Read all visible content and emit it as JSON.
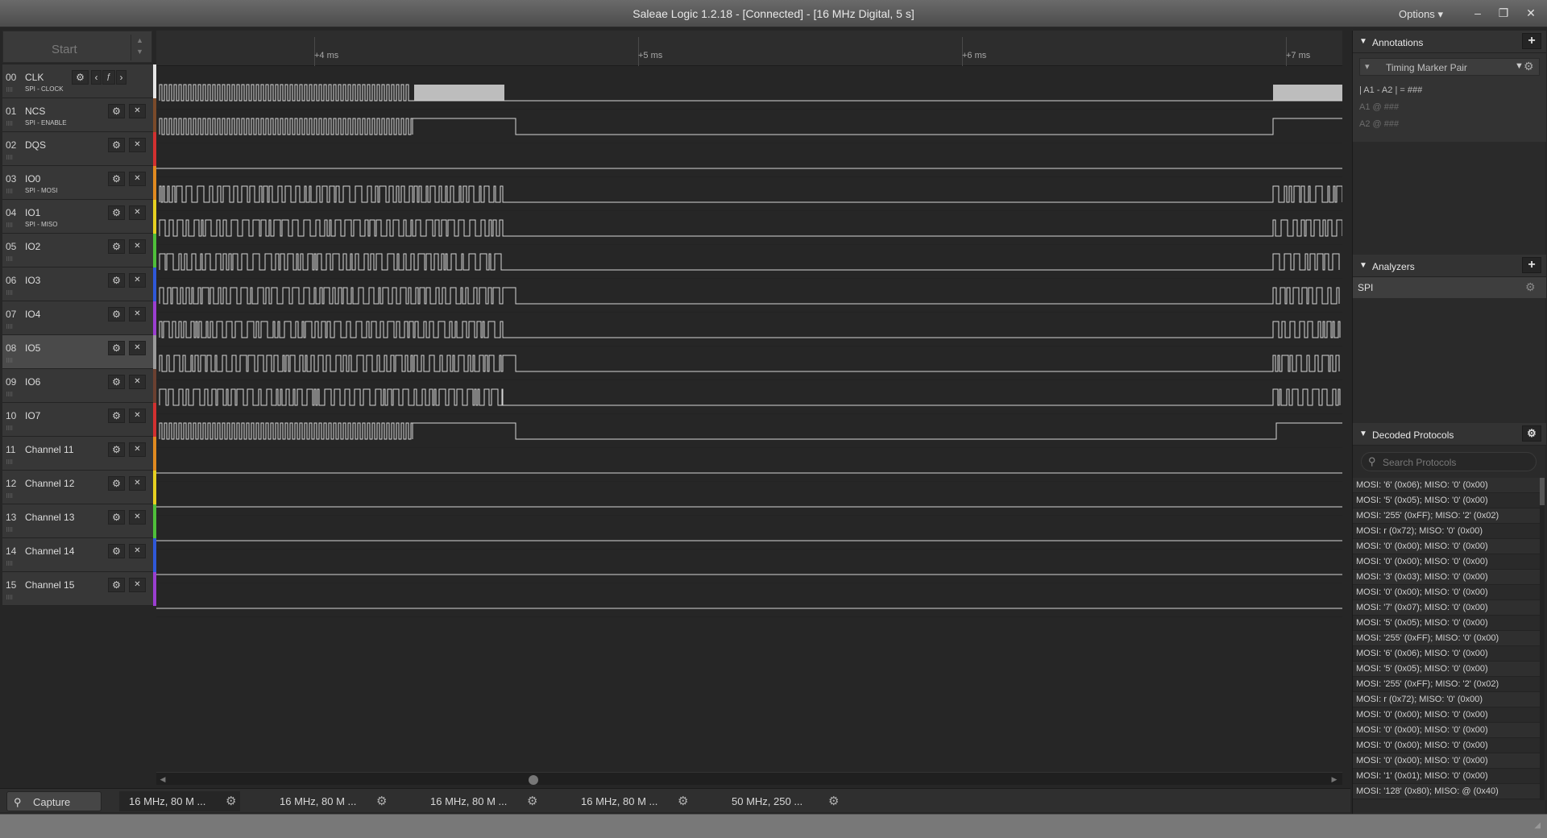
{
  "window": {
    "title": "Saleae Logic 1.2.18 - [Connected] - [16 MHz Digital, 5 s]",
    "options_label": "Options",
    "controls": [
      "–",
      "❐",
      "✕"
    ]
  },
  "start_button": {
    "label": "Start"
  },
  "ruler": {
    "ticks": [
      "+4 ms",
      "+5 ms",
      "+6 ms",
      "+7 ms"
    ]
  },
  "channels": [
    {
      "num": "00",
      "name": "CLK",
      "sub": "SPI - CLOCK",
      "color": "#e6e6e6",
      "selected": false
    },
    {
      "num": "01",
      "name": "NCS",
      "sub": "SPI - ENABLE",
      "color": "#7a4a2a",
      "selected": false
    },
    {
      "num": "02",
      "name": "DQS",
      "sub": "",
      "color": "#d23030",
      "selected": false
    },
    {
      "num": "03",
      "name": "IO0",
      "sub": "SPI - MOSI",
      "color": "#e08a20",
      "selected": false
    },
    {
      "num": "04",
      "name": "IO1",
      "sub": "SPI - MISO",
      "color": "#e6d020",
      "selected": false
    },
    {
      "num": "05",
      "name": "IO2",
      "sub": "",
      "color": "#4fbf3a",
      "selected": false
    },
    {
      "num": "06",
      "name": "IO3",
      "sub": "",
      "color": "#2f58d8",
      "selected": false
    },
    {
      "num": "07",
      "name": "IO4",
      "sub": "",
      "color": "#9b3fd0",
      "selected": false
    },
    {
      "num": "08",
      "name": "IO5",
      "sub": "",
      "color": "#9a9a9a",
      "selected": true
    },
    {
      "num": "09",
      "name": "IO6",
      "sub": "",
      "color": "#6a4030",
      "selected": false
    },
    {
      "num": "10",
      "name": "IO7",
      "sub": "",
      "color": "#d23030",
      "selected": false
    },
    {
      "num": "11",
      "name": "Channel 11",
      "sub": "",
      "color": "#e08a20",
      "selected": false
    },
    {
      "num": "12",
      "name": "Channel 12",
      "sub": "",
      "color": "#e6d020",
      "selected": false
    },
    {
      "num": "13",
      "name": "Channel 13",
      "sub": "",
      "color": "#4fbf3a",
      "selected": false
    },
    {
      "num": "14",
      "name": "Channel 14",
      "sub": "",
      "color": "#2f58d8",
      "selected": false
    },
    {
      "num": "15",
      "name": "Channel 15",
      "sub": "",
      "color": "#9b3fd0",
      "selected": false
    }
  ],
  "tabs": {
    "capture_label": "Capture",
    "sessions": [
      "16 MHz, 80 M ...",
      "16 MHz, 80 M ...",
      "16 MHz, 80 M ...",
      "16 MHz, 80 M ...",
      "50 MHz, 250 ..."
    ],
    "active_index": 0
  },
  "annotations": {
    "title": "Annotations",
    "marker_type": "Timing Marker Pair",
    "delta_line": "| A1 - A2 | = ###",
    "a1_line": "A1  @  ###",
    "a2_line": "A2  @  ###"
  },
  "analyzers": {
    "title": "Analyzers",
    "items": [
      "SPI"
    ]
  },
  "decoded": {
    "title": "Decoded Protocols",
    "search_placeholder": "Search Protocols",
    "rows": [
      "MOSI: '6' (0x06);  MISO: '0' (0x00)",
      "MOSI: '5' (0x05);  MISO: '0' (0x00)",
      "MOSI: '255' (0xFF);  MISO: '2' (0x02)",
      "MOSI: r (0x72);  MISO: '0' (0x00)",
      "MOSI: '0' (0x00);  MISO: '0' (0x00)",
      "MOSI: '0' (0x00);  MISO: '0' (0x00)",
      "MOSI: '3' (0x03);  MISO: '0' (0x00)",
      "MOSI: '0' (0x00);  MISO: '0' (0x00)",
      "MOSI: '7' (0x07);  MISO: '0' (0x00)",
      "MOSI: '5' (0x05);  MISO: '0' (0x00)",
      "MOSI: '255' (0xFF);  MISO: '0' (0x00)",
      "MOSI: '6' (0x06);  MISO: '0' (0x00)",
      "MOSI: '5' (0x05);  MISO: '0' (0x00)",
      "MOSI: '255' (0xFF);  MISO: '2' (0x02)",
      "MOSI: r (0x72);  MISO: '0' (0x00)",
      "MOSI: '0' (0x00);  MISO: '0' (0x00)",
      "MOSI: '0' (0x00);  MISO: '0' (0x00)",
      "MOSI: '0' (0x00);  MISO: '0' (0x00)",
      "MOSI: '0' (0x00);  MISO: '0' (0x00)",
      "MOSI: '1' (0x01);  MISO: '0' (0x00)",
      "MOSI: '128' (0x80);  MISO: @ (0x40)"
    ]
  }
}
